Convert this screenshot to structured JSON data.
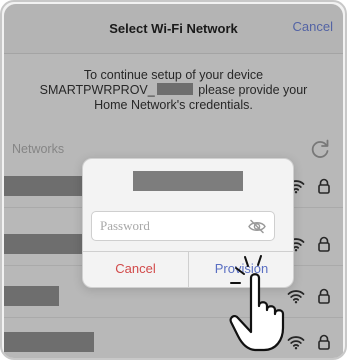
{
  "header": {
    "title": "Select Wi-Fi Network",
    "cancel_label": "Cancel"
  },
  "instructions": {
    "line1": "To continue setup of your device",
    "line2_prefix": "SMARTPWRPROV_",
    "line2_suffix": "please provide your",
    "line3": "Home Network's credentials."
  },
  "networks": {
    "label": "Networks",
    "refresh_icon": "refresh-icon",
    "rows_count_visible": 4
  },
  "dialog": {
    "password_placeholder": "Password",
    "password_value": "",
    "visibility_icon": "eye-slash-icon",
    "cancel_label": "Cancel",
    "provision_label": "Provision"
  },
  "colors": {
    "accent": "#5a6fc2",
    "destructive": "#d24a4a",
    "redaction": "#7d7d7d"
  }
}
